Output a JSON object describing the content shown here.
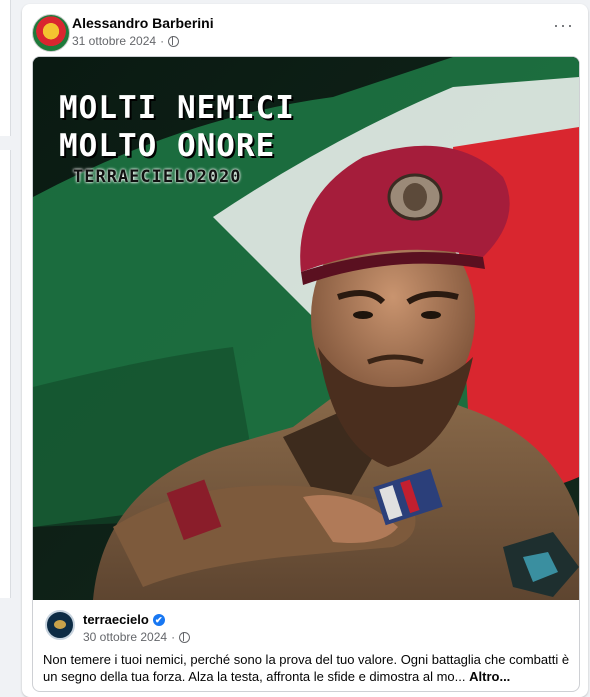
{
  "post": {
    "author": "Alessandro Barberini",
    "date": "31 ottobre 2024",
    "separator": "·",
    "more_label": "···"
  },
  "image_overlay": {
    "line1": "MOLTI NEMICI",
    "line2": "MOLTO ONORE",
    "watermark": "TERRAECIELO2020"
  },
  "shared_page": {
    "name": "terraecielo",
    "verified_icon": "✔",
    "date": "30 ottobre 2024",
    "separator": "·",
    "text": "Non temere i tuoi nemici, perché sono la prova del tuo valore. Ogni battaglia che combatti è un segno della tua forza. Alza la testa, affronta le sfide e dimostra al mo...",
    "see_more": "Altro..."
  },
  "colors": {
    "facebook_blue": "#1877f2",
    "beret": "#a51d3b",
    "flag_green": "#1a6b3c",
    "flag_red": "#d9262f"
  }
}
